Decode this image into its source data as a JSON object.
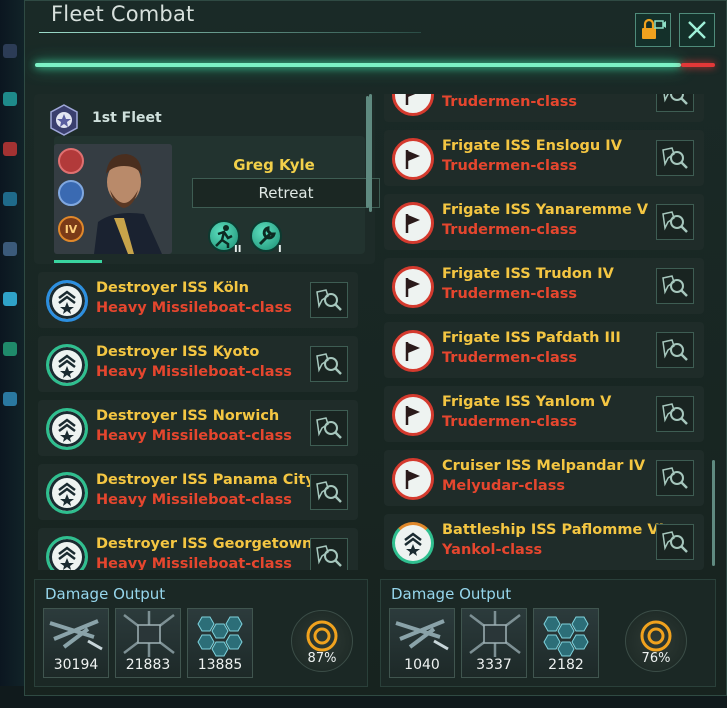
{
  "window": {
    "title": "Fleet Combat",
    "close_label": "×",
    "combat_progress_percent": 95
  },
  "left_fleet": {
    "fleet_name": "1st Fleet",
    "leader": {
      "name": "Greg Kyle",
      "rank": "IV",
      "trait_levels": [
        "II",
        "I"
      ]
    },
    "retreat_label": "Retreat",
    "ships": [
      {
        "name": "Destroyer ISS Köln",
        "class": "Heavy Missileboat-class"
      },
      {
        "name": "Destroyer ISS Kyoto",
        "class": "Heavy Missileboat-class"
      },
      {
        "name": "Destroyer ISS Norwich",
        "class": "Heavy Missileboat-class"
      },
      {
        "name": "Destroyer ISS Panama City",
        "class": "Heavy Missileboat-class"
      },
      {
        "name": "Destroyer ISS Georgetown",
        "class": "Heavy Missileboat-class"
      }
    ],
    "damage": {
      "title": "Damage Output",
      "weapons": [
        {
          "icon": "kinetic-weapon-icon",
          "value": "30194"
        },
        {
          "icon": "missile-weapon-icon",
          "value": "21883"
        },
        {
          "icon": "shield-hex-icon",
          "value": "13885"
        }
      ],
      "efficiency": "87%"
    }
  },
  "right_fleet": {
    "ships": [
      {
        "name": "",
        "class": "Trudermen-class"
      },
      {
        "name": "Frigate ISS Enslogu IV",
        "class": "Trudermen-class"
      },
      {
        "name": "Frigate ISS Yanaremme V",
        "class": "Trudermen-class"
      },
      {
        "name": "Frigate ISS Trudon IV",
        "class": "Trudermen-class"
      },
      {
        "name": "Frigate ISS Pafdath III",
        "class": "Trudermen-class"
      },
      {
        "name": "Frigate ISS Yanlom V",
        "class": "Trudermen-class"
      },
      {
        "name": "Cruiser ISS Melpandar IV",
        "class": "Melyudar-class"
      },
      {
        "name": "Battleship ISS Paflomme VI",
        "class": "Yankol-class"
      }
    ],
    "damage": {
      "title": "Damage Output",
      "weapons": [
        {
          "icon": "kinetic-weapon-icon",
          "value": "1040"
        },
        {
          "icon": "missile-weapon-icon",
          "value": "3337"
        },
        {
          "icon": "shield-hex-icon",
          "value": "2182"
        }
      ],
      "efficiency": "76%"
    }
  },
  "colors": {
    "ship_name": "#f4c642",
    "ship_class": "#e5462e",
    "progress_glow": "#7cf2c6",
    "enemy_marker": "#e23838"
  }
}
